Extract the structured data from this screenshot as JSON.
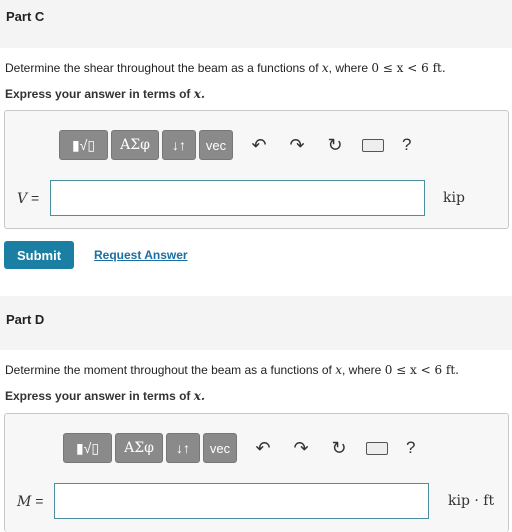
{
  "partC": {
    "title": "Part C",
    "prompt_text": "Determine the shear throughout the beam as a functions of",
    "prompt_var": "x",
    "prompt_mid": ", where",
    "prompt_range": "0 ≤ x < 6 ft.",
    "instruction": "Express your answer in terms of",
    "instruction_var": "x.",
    "variable": "V",
    "equals": "=",
    "input_value": "",
    "unit": "kip",
    "submit_label": "Submit",
    "request_label": "Request Answer"
  },
  "partD": {
    "title": "Part D",
    "prompt_text": "Determine the moment throughout the beam as a functions of",
    "prompt_var": "x",
    "prompt_mid": ", where",
    "prompt_range": "0 ≤ x < 6 ft.",
    "instruction": "Express your answer in terms of",
    "instruction_var": "x.",
    "variable": "M",
    "equals": "=",
    "input_value": "",
    "unit": "kip · ft"
  },
  "toolbar": {
    "templates_label": "▮√▯",
    "greek_label": "ΑΣφ",
    "arrows_label": "↓↑",
    "vec_label": "vec",
    "undo_icon": "↶",
    "redo_icon": "↷",
    "reset_icon": "↻",
    "help_label": "?"
  }
}
